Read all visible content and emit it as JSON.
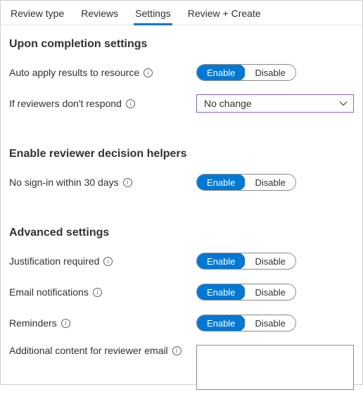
{
  "tabs": {
    "review_type": "Review type",
    "reviews": "Reviews",
    "settings": "Settings",
    "review_create": "Review + Create",
    "active": "settings"
  },
  "sections": {
    "completion": {
      "title": "Upon completion settings",
      "auto_apply": {
        "label": "Auto apply results to resource",
        "enable": "Enable",
        "disable": "Disable"
      },
      "no_respond": {
        "label": "If reviewers don't respond",
        "value": "No change"
      }
    },
    "helpers": {
      "title": "Enable reviewer decision helpers",
      "no_signin": {
        "label": "No sign-in within 30 days",
        "enable": "Enable",
        "disable": "Disable"
      }
    },
    "advanced": {
      "title": "Advanced settings",
      "justification": {
        "label": "Justification required",
        "enable": "Enable",
        "disable": "Disable"
      },
      "email": {
        "label": "Email notifications",
        "enable": "Enable",
        "disable": "Disable"
      },
      "reminders": {
        "label": "Reminders",
        "enable": "Enable",
        "disable": "Disable"
      },
      "additional": {
        "label": "Additional content for reviewer email",
        "value": ""
      }
    }
  }
}
